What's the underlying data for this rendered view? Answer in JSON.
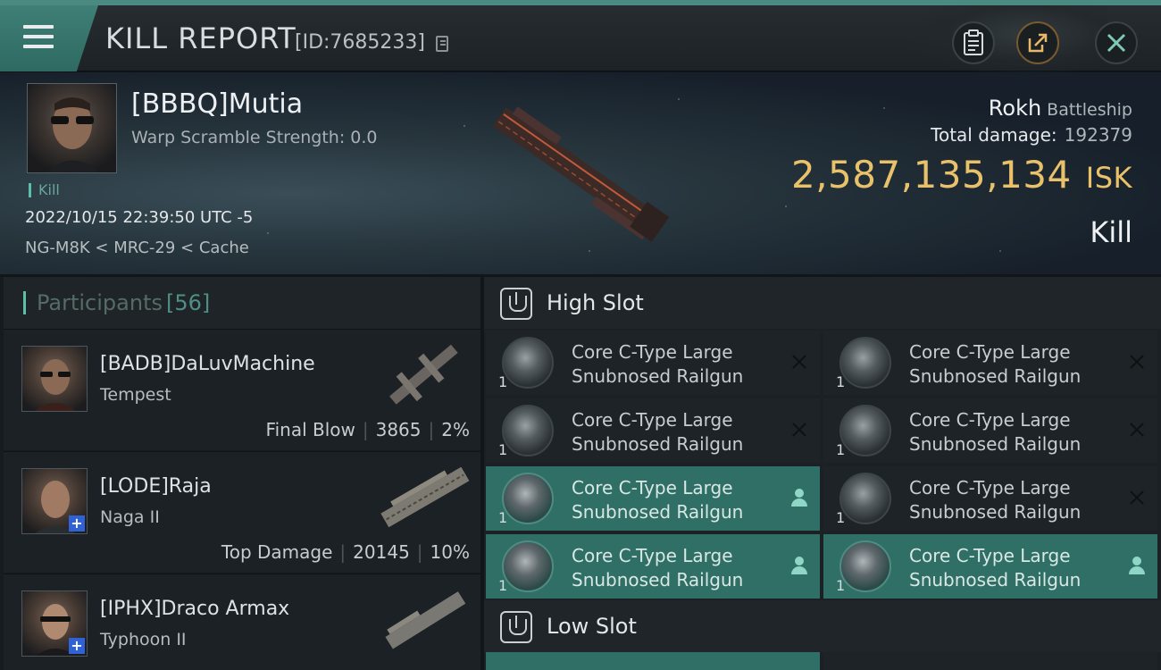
{
  "header": {
    "title": "KILL REPORT",
    "report_id": "[ID:7685233]"
  },
  "victim": {
    "name": "[BBBQ]Mutia",
    "warp_scramble": "Warp Scramble Strength: 0.0",
    "tag": "Kill",
    "datetime": "2022/10/15 22:39:50 UTC -5",
    "location": "NG-M8K < MRC-29 < Cache",
    "ship_name": "Rokh",
    "ship_class": "Battleship",
    "total_damage_label": "Total damage:",
    "total_damage_value": "192379",
    "isk_value": "2,587,135,134",
    "isk_unit": "ISK",
    "result": "Kill"
  },
  "participants": {
    "title": "Participants",
    "count": "[56]",
    "items": [
      {
        "name": "[BADB]DaLuvMachine",
        "ship": "Tempest",
        "role": "Final Blow",
        "damage": "3865",
        "percent": "2%",
        "plus": false
      },
      {
        "name": "[LODE]Raja",
        "ship": "Naga II",
        "role": "Top Damage",
        "damage": "20145",
        "percent": "10%",
        "plus": true
      },
      {
        "name": "[IPHX]Draco Armax",
        "ship": "Typhoon II",
        "role": "",
        "damage": "",
        "percent": "",
        "plus": true
      }
    ]
  },
  "fitting": {
    "high_slot_title": "High Slot",
    "low_slot_title": "Low Slot",
    "high_modules": [
      {
        "name_line1": "Core C-Type Large",
        "name_line2": "Snubnosed Railgun",
        "qty": "1",
        "status": "destroyed"
      },
      {
        "name_line1": "Core C-Type Large",
        "name_line2": "Snubnosed Railgun",
        "qty": "1",
        "status": "destroyed"
      },
      {
        "name_line1": "Core C-Type Large",
        "name_line2": "Snubnosed Railgun",
        "qty": "1",
        "status": "destroyed"
      },
      {
        "name_line1": "Core C-Type Large",
        "name_line2": "Snubnosed Railgun",
        "qty": "1",
        "status": "destroyed"
      },
      {
        "name_line1": "Core C-Type Large",
        "name_line2": "Snubnosed Railgun",
        "qty": "1",
        "status": "dropped"
      },
      {
        "name_line1": "Core C-Type Large",
        "name_line2": "Snubnosed Railgun",
        "qty": "1",
        "status": "destroyed"
      },
      {
        "name_line1": "Core C-Type Large",
        "name_line2": "Snubnosed Railgun",
        "qty": "1",
        "status": "dropped"
      },
      {
        "name_line1": "Core C-Type Large",
        "name_line2": "Snubnosed Railgun",
        "qty": "1",
        "status": "dropped"
      }
    ]
  },
  "colors": {
    "accent_teal": "#5bbfa9",
    "isk_gold": "#e9c16a",
    "dropped_bg": "#2f6f66"
  },
  "icons": [
    "menu-icon",
    "copy-icon",
    "clipboard-icon",
    "share-icon",
    "close-icon",
    "high-slot-icon",
    "low-slot-icon",
    "destroyed-x-icon",
    "dropped-person-icon"
  ]
}
